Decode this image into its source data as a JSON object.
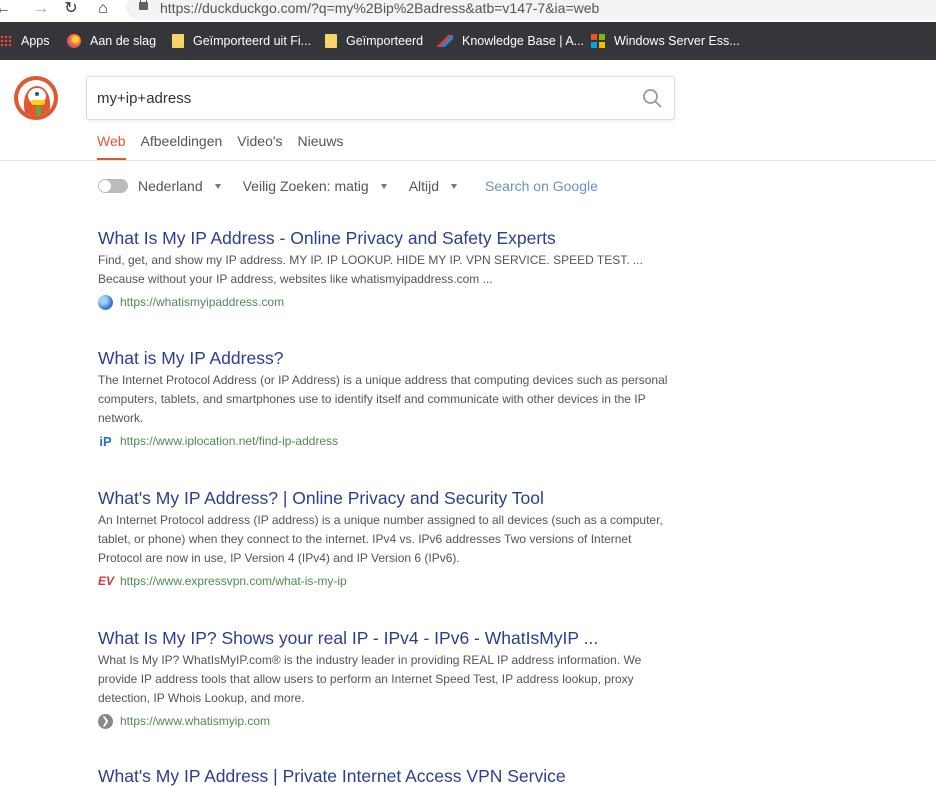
{
  "browser": {
    "url": "https://duckduckgo.com/?q=my%2Bip%2Badress&atb=v147-7&ia=web",
    "bookmarks": [
      {
        "label": "Apps",
        "icon": "apps-grid-icon"
      },
      {
        "label": "Aan de slag",
        "icon": "firefox-icon"
      },
      {
        "label": "Geïmporteerd uit Fi...",
        "icon": "folder-icon"
      },
      {
        "label": "Geïmporteerd",
        "icon": "folder-icon"
      },
      {
        "label": "Knowledge Base | A...",
        "icon": "knowledge-base-icon"
      },
      {
        "label": "Windows Server Ess...",
        "icon": "windows-icon"
      }
    ]
  },
  "search": {
    "query": "my+ip+adress"
  },
  "tabs": [
    {
      "label": "Web",
      "active": true
    },
    {
      "label": "Afbeeldingen",
      "active": false
    },
    {
      "label": "Video's",
      "active": false
    },
    {
      "label": "Nieuws",
      "active": false
    }
  ],
  "filters": {
    "region": "Nederland",
    "safe_search": "Veilig Zoeken: matig",
    "time": "Altijd",
    "google_link": "Search on Google"
  },
  "results": [
    {
      "title": "What Is My IP Address - Online Privacy and Safety Experts",
      "snippet": "Find, get, and show my IP address. MY IP. IP LOOKUP. HIDE MY IP. VPN SERVICE. SPEED TEST. ... Because without your IP address, websites like whatismyipaddress.com ...",
      "url": "https://whatismyipaddress.com",
      "favicon": "globe-icon"
    },
    {
      "title": "What is My IP Address?",
      "snippet": "The Internet Protocol Address (or IP Address) is a unique address that computing devices such as personal computers, tablets, and smartphones use to identify itself and communicate with other devices in the IP network.",
      "url": "https://www.iplocation.net/find-ip-address",
      "favicon": "iplocation-icon",
      "favicon_text": "iP"
    },
    {
      "title": "What's My IP Address? | Online Privacy and Security Tool",
      "snippet": "An Internet Protocol address (IP address) is a unique number assigned to all devices (such as a computer, tablet, or phone) when they connect to the internet. IPv4 vs. IPv6 addresses Two versions of Internet Protocol are now in use, IP Version 4 (IPv4) and IP Version 6 (IPv6).",
      "url": "https://www.expressvpn.com/what-is-my-ip",
      "favicon": "expressvpn-icon",
      "favicon_text": "EV"
    },
    {
      "title": "What Is My IP? Shows your real IP - IPv4 - IPv6 - WhatIsMyIP ...",
      "snippet": "What Is My IP? WhatIsMyIP.com® is the industry leader in providing REAL IP address information. We provide IP address tools that allow users to perform an Internet Speed Test, IP address lookup, proxy detection, IP Whois Lookup, and more.",
      "url": "https://www.whatismyip.com",
      "favicon": "arrow-icon",
      "favicon_text": "❯"
    },
    {
      "title": "What's My IP Address | Private Internet Access VPN Service"
    }
  ]
}
